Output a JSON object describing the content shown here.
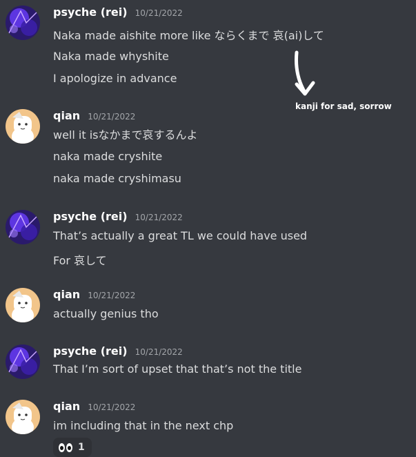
{
  "messages": [
    {
      "user": "psyche (rei)",
      "time": "10/21/2022",
      "avatar": "psyche-avatar",
      "lines": [
        "Naka made aishite more like ならくまで 哀(ai)して",
        "Naka made whyshite",
        "I apologize in advance"
      ]
    },
    {
      "user": "qian",
      "time": "10/21/2022",
      "avatar": "qian-avatar",
      "lines": [
        "well it isなかまで哀するんよ",
        "naka made cryshite",
        "naka made cryshimasu"
      ]
    },
    {
      "user": "psyche (rei)",
      "time": "10/21/2022",
      "avatar": "psyche-avatar",
      "lines": [
        "That’s actually a great TL we could have used",
        "For 哀して"
      ]
    },
    {
      "user": "qian",
      "time": "10/21/2022",
      "avatar": "qian-avatar",
      "lines": [
        "actually genius tho"
      ]
    },
    {
      "user": "psyche (rei)",
      "time": "10/21/2022",
      "avatar": "psyche-avatar",
      "lines": [
        "That I’m sort of upset that that’s not the title"
      ]
    },
    {
      "user": "qian",
      "time": "10/21/2022",
      "avatar": "qian-avatar",
      "lines": [
        "im including that in the next chp"
      ]
    }
  ],
  "annotation": "kanji for sad, sorrow",
  "reaction": {
    "emoji": "eyes-icon",
    "count": "1"
  },
  "colors": {
    "background": "#36393f",
    "username": "#ffffff",
    "timestamp": "#a3a6aa",
    "text": "#dcddde"
  }
}
